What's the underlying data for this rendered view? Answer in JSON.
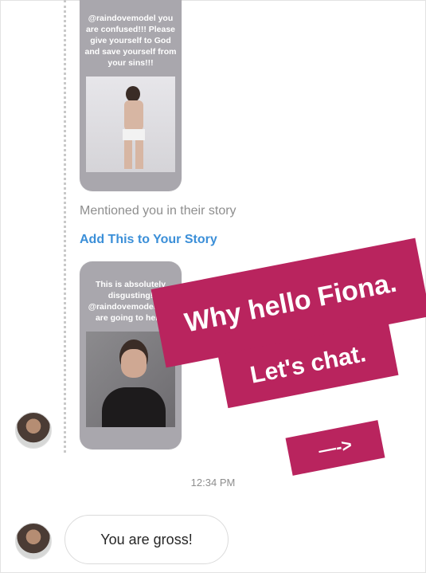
{
  "stories": [
    {
      "text": "@raindovemodel you are confused!!! Please give yourself to God and save yourself from your sins!!!",
      "photo_icon": "standing-person-photo"
    },
    {
      "text": "This is absolutely disgusting! @raindovemodel you are going to hell!!",
      "photo_icon": "portrait-photo"
    }
  ],
  "mention": {
    "label": "Mentioned you in their story",
    "action": "Add This to Your Story"
  },
  "timestamp": "12:34 PM",
  "message": {
    "text": "You are gross!"
  },
  "stickers": {
    "line1": "Why hello Fiona.",
    "line2": "Let's chat.",
    "arrow": "—->"
  },
  "colors": {
    "sticker": "#b9245e",
    "link": "#3b8fd8",
    "card": "#a9a7ad"
  }
}
